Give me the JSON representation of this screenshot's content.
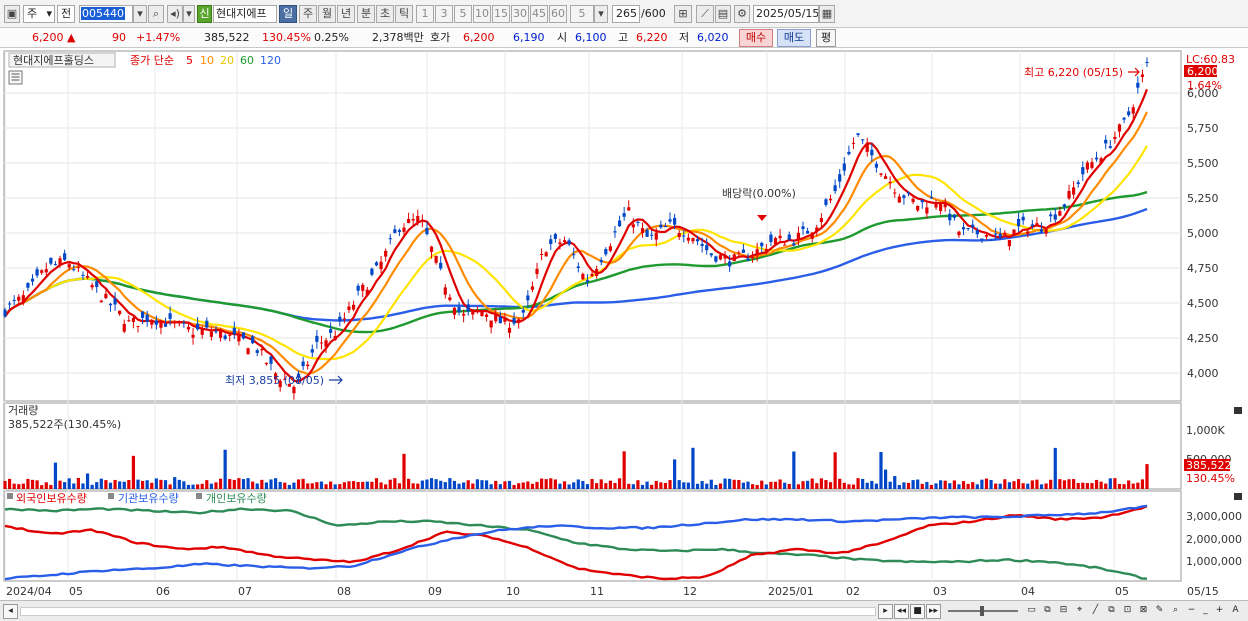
{
  "toolbar": {
    "period_label": "주",
    "prev_label": "전",
    "code": "005440",
    "credit_badge": "신",
    "stock_short_name": "현대지에프",
    "tf": [
      "일",
      "주",
      "월",
      "년",
      "분",
      "초",
      "틱"
    ],
    "tf_active": 0,
    "minute_presets": [
      "1",
      "3",
      "5",
      "10",
      "15",
      "30",
      "45",
      "60"
    ],
    "unit_value": "5",
    "bar_count": "265",
    "bar_max": "/600",
    "date": "2025/05/15"
  },
  "quote": {
    "price": "6,200 ▲",
    "change": "90",
    "change_pct": "+1.47%",
    "volume": "385,522",
    "volume_ratio": "130.45%",
    "turnover": "0.25%",
    "amount": "2,378백만",
    "bid_ask_label": "호가",
    "ask": "6,200",
    "bid": "6,190",
    "open_label": "시",
    "open": "6,100",
    "high_label": "고",
    "high": "6,220",
    "low_label": "저",
    "low": "6,020",
    "buy_label": "매수",
    "sell_label": "매도",
    "avg_label": "평"
  },
  "legend": {
    "name": "현대지에프홀딩스",
    "price_label": "종가 단순",
    "ma5": "5",
    "ma10": "10",
    "ma20": "20",
    "ma60": "60",
    "ma120": "120"
  },
  "colors": {
    "up": "#e00000",
    "down": "#0047c8",
    "ma5": "#e00000",
    "ma10": "#ff8c00",
    "ma20": "#ffe400",
    "ma60": "#1e9a2e",
    "ma120": "#2a5ee8",
    "foreign": "#e00000",
    "institution": "#2a5ee8",
    "individual": "#2e8b57"
  },
  "annotations": {
    "high": "최고 6,220 (05/15)",
    "low": "최저 3,855 (08/05)",
    "dividend": "배당락(0.00%)"
  },
  "price_axis": {
    "ticks": [
      "6,000",
      "5,750",
      "5,500",
      "5,250",
      "5,000",
      "4,750",
      "4,500",
      "4,250",
      "4,000"
    ],
    "lc": "LC:60.83",
    "last": "6,200",
    "last_pct": "1.64%"
  },
  "volume_panel": {
    "title": "거래량",
    "info": "385,522주(130.45%)",
    "ticks": [
      "1,000K",
      "500,000"
    ],
    "last": "385,522",
    "last_pct": "130.45%"
  },
  "holdings_panel": {
    "foreign_label": "외국인보유수량",
    "institution_label": "기관보유수량",
    "individual_label": "개인보유수량",
    "ticks": [
      "3,000,000",
      "2,000,000",
      "1,000,000"
    ]
  },
  "x_axis": {
    "labels": [
      "2024/04",
      "05",
      "06",
      "07",
      "08",
      "09",
      "10",
      "11",
      "12",
      "2025/01",
      "02",
      "03",
      "04",
      "05"
    ],
    "right_label": "05/15"
  },
  "chart_data": {
    "type": "candlestick",
    "x": [
      "2024/04",
      "05",
      "06",
      "07",
      "08",
      "09",
      "10",
      "11",
      "12",
      "2025/01",
      "02",
      "03",
      "04",
      "05"
    ],
    "ylim": [
      3800,
      6300
    ],
    "grid": true,
    "series": [
      {
        "name": "종가",
        "values": [
          4450,
          4550,
          4750,
          4800,
          4650,
          4500,
          4350,
          4400,
          4350,
          4300,
          4300,
          4250,
          4200,
          4000,
          3900,
          4200,
          4300,
          4550,
          4750,
          5050,
          5100,
          4700,
          4400,
          4450,
          4350,
          4400,
          4900,
          4950,
          4650,
          4900,
          5150,
          4950,
          5050,
          5000,
          4850,
          4800,
          4850,
          4950,
          4950,
          5050,
          5300,
          5700,
          5500,
          5300,
          5200,
          5250,
          5000,
          5000,
          4950,
          5050,
          5050,
          5200,
          5450,
          5600,
          5800,
          6200
        ]
      },
      {
        "name": "5",
        "values": [
          4480,
          4540,
          4700,
          4760,
          4680,
          4550,
          4380,
          4400,
          4360,
          4320,
          4300,
          4260,
          4230,
          4080,
          3980,
          4150,
          4280,
          4500,
          4700,
          4980,
          5060,
          4800,
          4500,
          4460,
          4380,
          4400,
          4800,
          4900,
          4720,
          4880,
          5100,
          4980,
          5040,
          5000,
          4870,
          4810,
          4840,
          4920,
          4950,
          5030,
          5250,
          5600,
          5520,
          5330,
          5230,
          5220,
          5050,
          5000,
          4970,
          5030,
          5070,
          5200,
          5380,
          5540,
          5760,
          5970
        ]
      }
    ],
    "ma_periods": [
      "5",
      "10",
      "20",
      "60",
      "120"
    ],
    "volume": {
      "last": 385522,
      "max_label": "1,000K"
    },
    "holdings": {
      "foreign_label": "외국인보유수량",
      "institution_label": "기관보유수량",
      "individual_label": "개인보유수량",
      "foreign_end": 3500000,
      "institution_end": 3500000,
      "individual_end": 100000
    },
    "annotations": [
      "최고 6,220 (05/15)",
      "최저 3,855 (08/05)",
      "배당락(0.00%)"
    ]
  }
}
